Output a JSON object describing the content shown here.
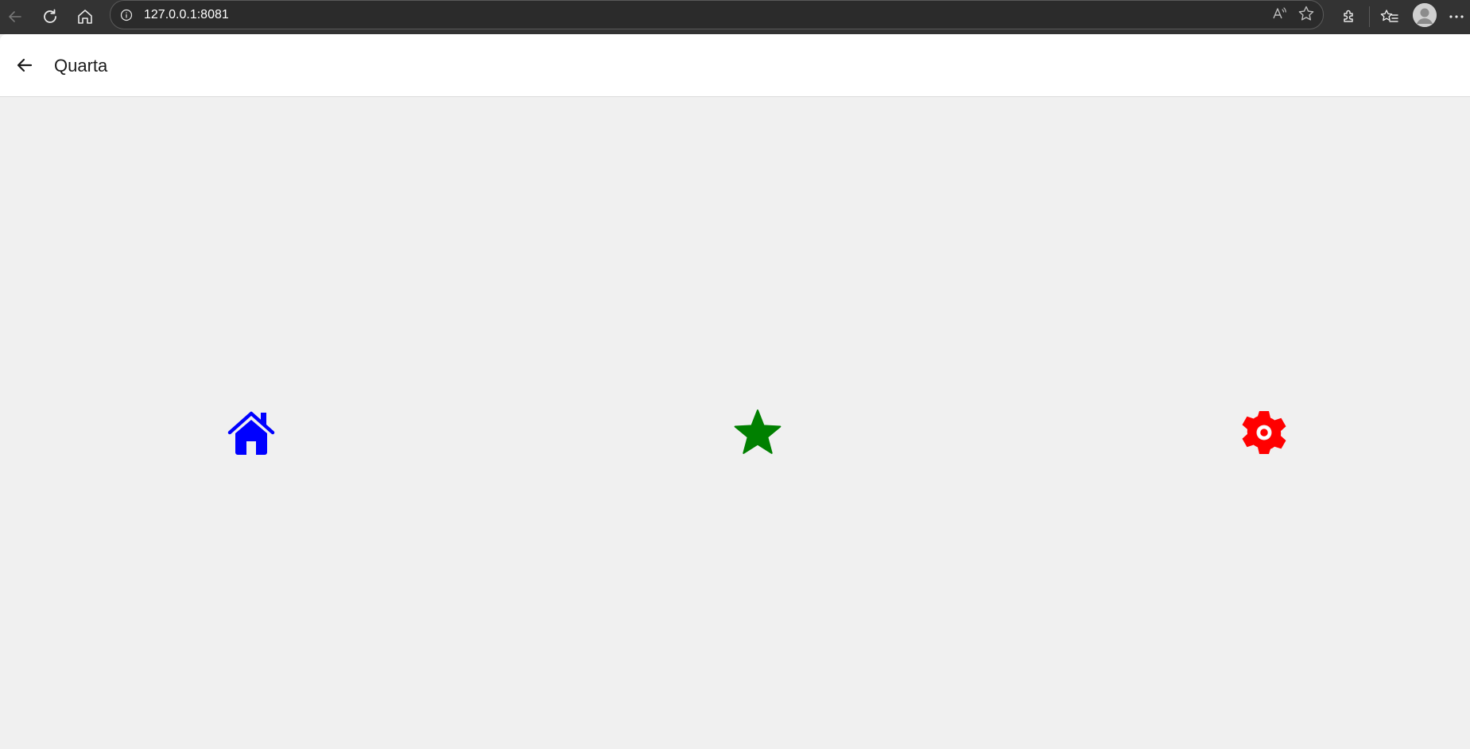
{
  "browser": {
    "url": "127.0.0.1:8081",
    "icons": {
      "back": "back-arrow-icon",
      "refresh": "refresh-icon",
      "home": "home-icon",
      "info": "info-icon",
      "read_aloud": "read-aloud-icon",
      "favorite": "star-outline-icon",
      "extensions": "puzzle-icon",
      "favorites": "favorites-list-icon",
      "profile": "profile-avatar-icon",
      "menu": "more-dots-icon"
    }
  },
  "header": {
    "title": "Quarta",
    "back_icon": "arrow-left-icon"
  },
  "main": {
    "icons": [
      {
        "name": "home-icon",
        "color": "#0000ff"
      },
      {
        "name": "star-icon",
        "color": "#008000"
      },
      {
        "name": "settings-icon",
        "color": "#ff0000"
      }
    ]
  }
}
